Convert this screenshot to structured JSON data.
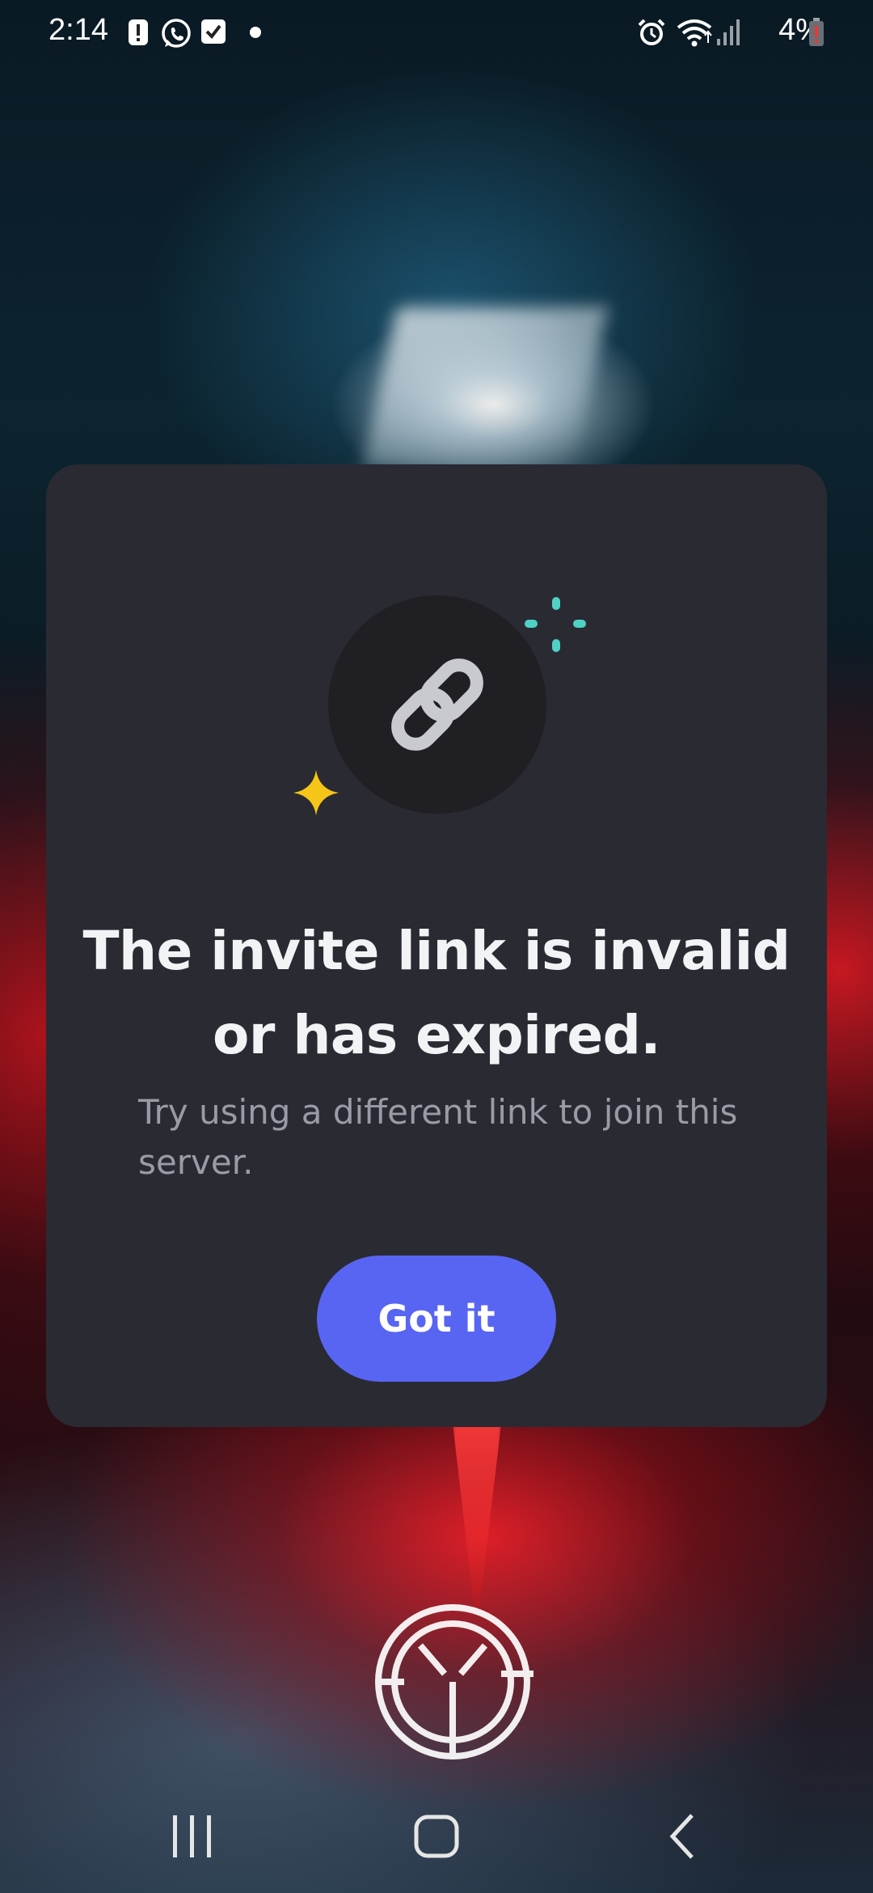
{
  "status_bar": {
    "time": "2:14",
    "battery_percent": "4%",
    "left_icons": [
      "alert-notification-icon",
      "whatsapp-icon",
      "checkbox-notification-icon",
      "dot-icon"
    ],
    "right_icons": [
      "alarm-icon",
      "wifi-icon",
      "signal-icon",
      "battery-low-icon"
    ]
  },
  "dialog": {
    "icon": "link-icon",
    "title": "The invite link is invalid or has expired.",
    "subtitle": "Try using a different link to join this server.",
    "button_label": "Got it",
    "colors": {
      "card_background": "#2a2a33",
      "button": "#5865f2",
      "sparkle_yellow": "#f5c518",
      "sparkle_teal": "#4fd1c5"
    }
  },
  "nav_bar": {
    "buttons": [
      "recents-icon",
      "home-icon",
      "back-icon"
    ]
  }
}
